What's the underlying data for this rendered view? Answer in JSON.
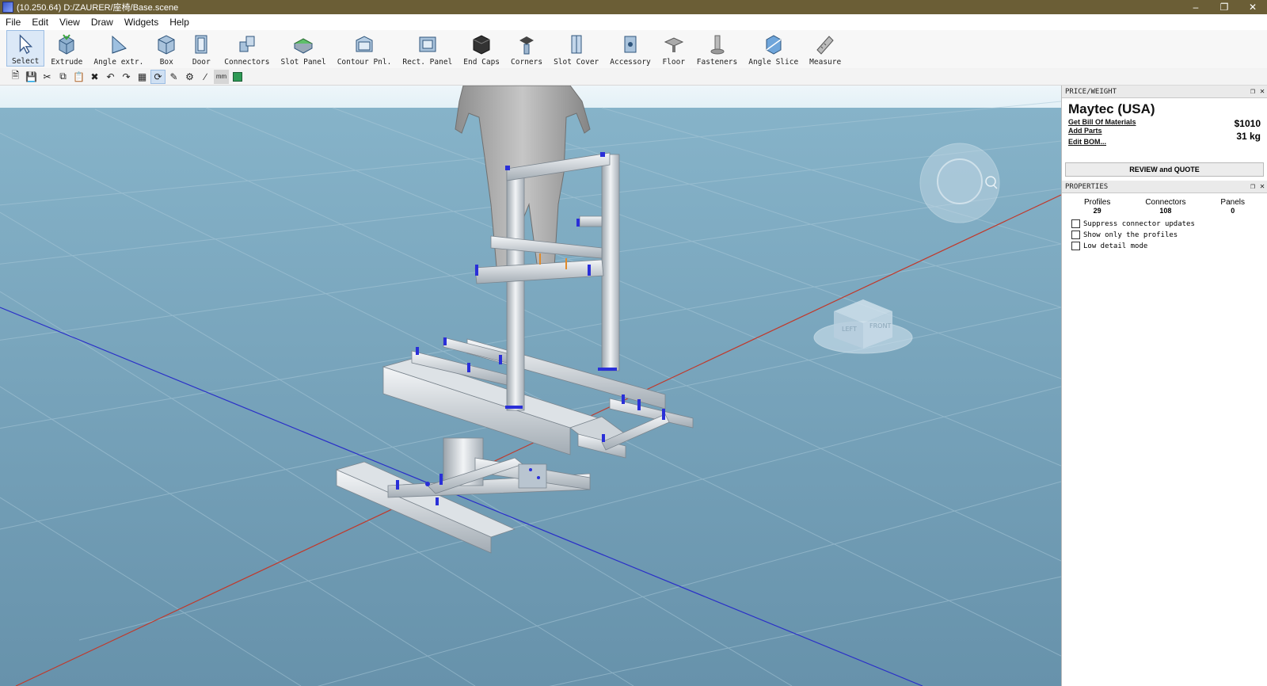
{
  "window": {
    "title": "(10.250.64) D:/ZAURER/座椅/Base.scene",
    "controls": [
      "minimize-icon",
      "restore-icon",
      "close-icon"
    ]
  },
  "menu": [
    "File",
    "Edit",
    "View",
    "Draw",
    "Widgets",
    "Help"
  ],
  "tools": [
    {
      "label": "Select",
      "icon": "select-arrow-icon",
      "active": true
    },
    {
      "label": "Extrude",
      "icon": "extrude-icon"
    },
    {
      "label": "Angle extr.",
      "icon": "angle-extrude-icon"
    },
    {
      "label": "Box",
      "icon": "box-icon"
    },
    {
      "label": "Door",
      "icon": "door-icon"
    },
    {
      "label": "Connectors",
      "icon": "connectors-icon"
    },
    {
      "label": "Slot Panel",
      "icon": "slot-panel-icon"
    },
    {
      "label": "Contour Pnl.",
      "icon": "contour-panel-icon"
    },
    {
      "label": "Rect. Panel",
      "icon": "rect-panel-icon"
    },
    {
      "label": "End Caps",
      "icon": "end-caps-icon"
    },
    {
      "label": "Corners",
      "icon": "corners-icon"
    },
    {
      "label": "Slot Cover",
      "icon": "slot-cover-icon"
    },
    {
      "label": "Accessory",
      "icon": "accessory-icon"
    },
    {
      "label": "Floor",
      "icon": "floor-icon"
    },
    {
      "label": "Fasteners",
      "icon": "fasteners-icon"
    },
    {
      "label": "Angle Slice",
      "icon": "angle-slice-icon"
    },
    {
      "label": "Measure",
      "icon": "measure-icon"
    }
  ],
  "toolbar2": {
    "unit_label": "mm",
    "icons": [
      "new-file-icon",
      "save-icon",
      "cut-icon",
      "copy-icon",
      "paste-icon",
      "delete-icon",
      "undo-icon",
      "redo-icon",
      "grid-icon",
      "rotate-icon",
      "edit-icon",
      "settings-icon",
      "measure-line-icon",
      "units-icon",
      "color-icon"
    ]
  },
  "price_weight": {
    "header": "PRICE/WEIGHT",
    "vendor": "Maytec (USA)",
    "price": "$1010",
    "weight": "31 kg",
    "links": [
      "Get Bill Of Materials",
      "Add Parts",
      "Edit BOM..."
    ],
    "quote_button": "REVIEW and QUOTE"
  },
  "properties": {
    "header": "PROPERTIES",
    "counts": [
      {
        "label": "Profiles",
        "value": "29"
      },
      {
        "label": "Connectors",
        "value": "108"
      },
      {
        "label": "Panels",
        "value": "0"
      }
    ],
    "checkboxes": [
      {
        "label": "Suppress connector updates",
        "checked": false
      },
      {
        "label": "Show only the profiles",
        "checked": false
      },
      {
        "label": "Low detail mode",
        "checked": false
      }
    ]
  },
  "viewcube": {
    "left": "LEFT",
    "front": "FRONT"
  },
  "colors": {
    "titlebar": "#6b5e36",
    "grid_bg": "#6f9fb9",
    "x_axis": "#c0392b",
    "z_axis": "#2a2fc8",
    "connector": "#2a2fd8"
  }
}
